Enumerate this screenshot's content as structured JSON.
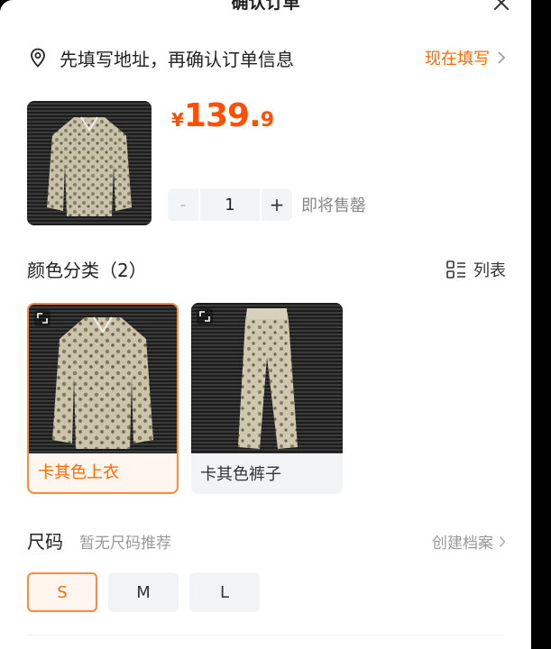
{
  "header": {
    "title": "确认订单"
  },
  "address": {
    "prompt": "先填写地址，再确认订单信息",
    "action": "现在填写"
  },
  "product": {
    "price_currency": "¥",
    "price_integer": "139.",
    "price_decimal": "9"
  },
  "quantity": {
    "value": "1",
    "minus": "-",
    "plus": "+",
    "note": "即将售罄"
  },
  "color_section": {
    "title": "颜色分类（2）",
    "view_toggle": "列表",
    "options": [
      {
        "label": "卡其色上衣",
        "selected": true
      },
      {
        "label": "卡其色裤子",
        "selected": false
      }
    ]
  },
  "size_section": {
    "title": "尺码",
    "hint": "暂无尺码推荐",
    "action": "创建档案",
    "options": [
      {
        "label": "S",
        "selected": true
      },
      {
        "label": "M",
        "selected": false
      },
      {
        "label": "L",
        "selected": false
      }
    ]
  },
  "colors": {
    "accent": "#ff6a00",
    "price": "#ff5000",
    "selected_border": "#ff8a3d",
    "chip_bg": "#f2f3f5"
  }
}
